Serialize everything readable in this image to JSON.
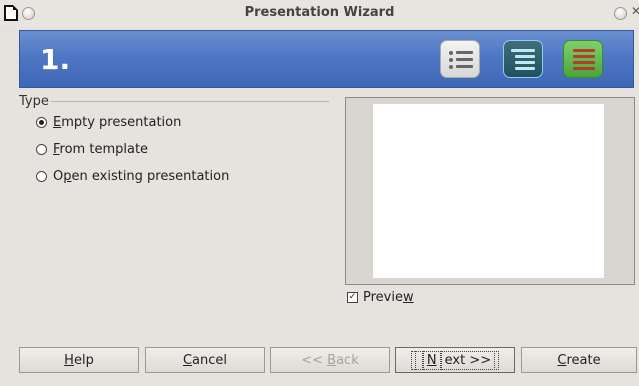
{
  "window": {
    "title": "Presentation Wizard"
  },
  "banner": {
    "step": "1."
  },
  "type_frame": {
    "label": "Type",
    "options": [
      {
        "pre": "",
        "u": "E",
        "post": "mpty presentation",
        "selected": true
      },
      {
        "pre": "",
        "u": "F",
        "post": "rom template",
        "selected": false
      },
      {
        "pre": "O",
        "u": "p",
        "post": "en existing presentation",
        "selected": false
      }
    ]
  },
  "preview": {
    "pre": "Previe",
    "u": "w",
    "post": "",
    "checked": true
  },
  "buttons": {
    "help": {
      "pre": "",
      "u": "H",
      "post": "elp"
    },
    "cancel": {
      "pre": "",
      "u": "C",
      "post": "ancel"
    },
    "back": {
      "pre": "<< ",
      "u": "B",
      "post": "ack",
      "disabled": true
    },
    "next": {
      "pre": "",
      "u": "N",
      "post": "ext >>"
    },
    "create": {
      "pre": "",
      "u": "C",
      "post": "reate"
    }
  }
}
